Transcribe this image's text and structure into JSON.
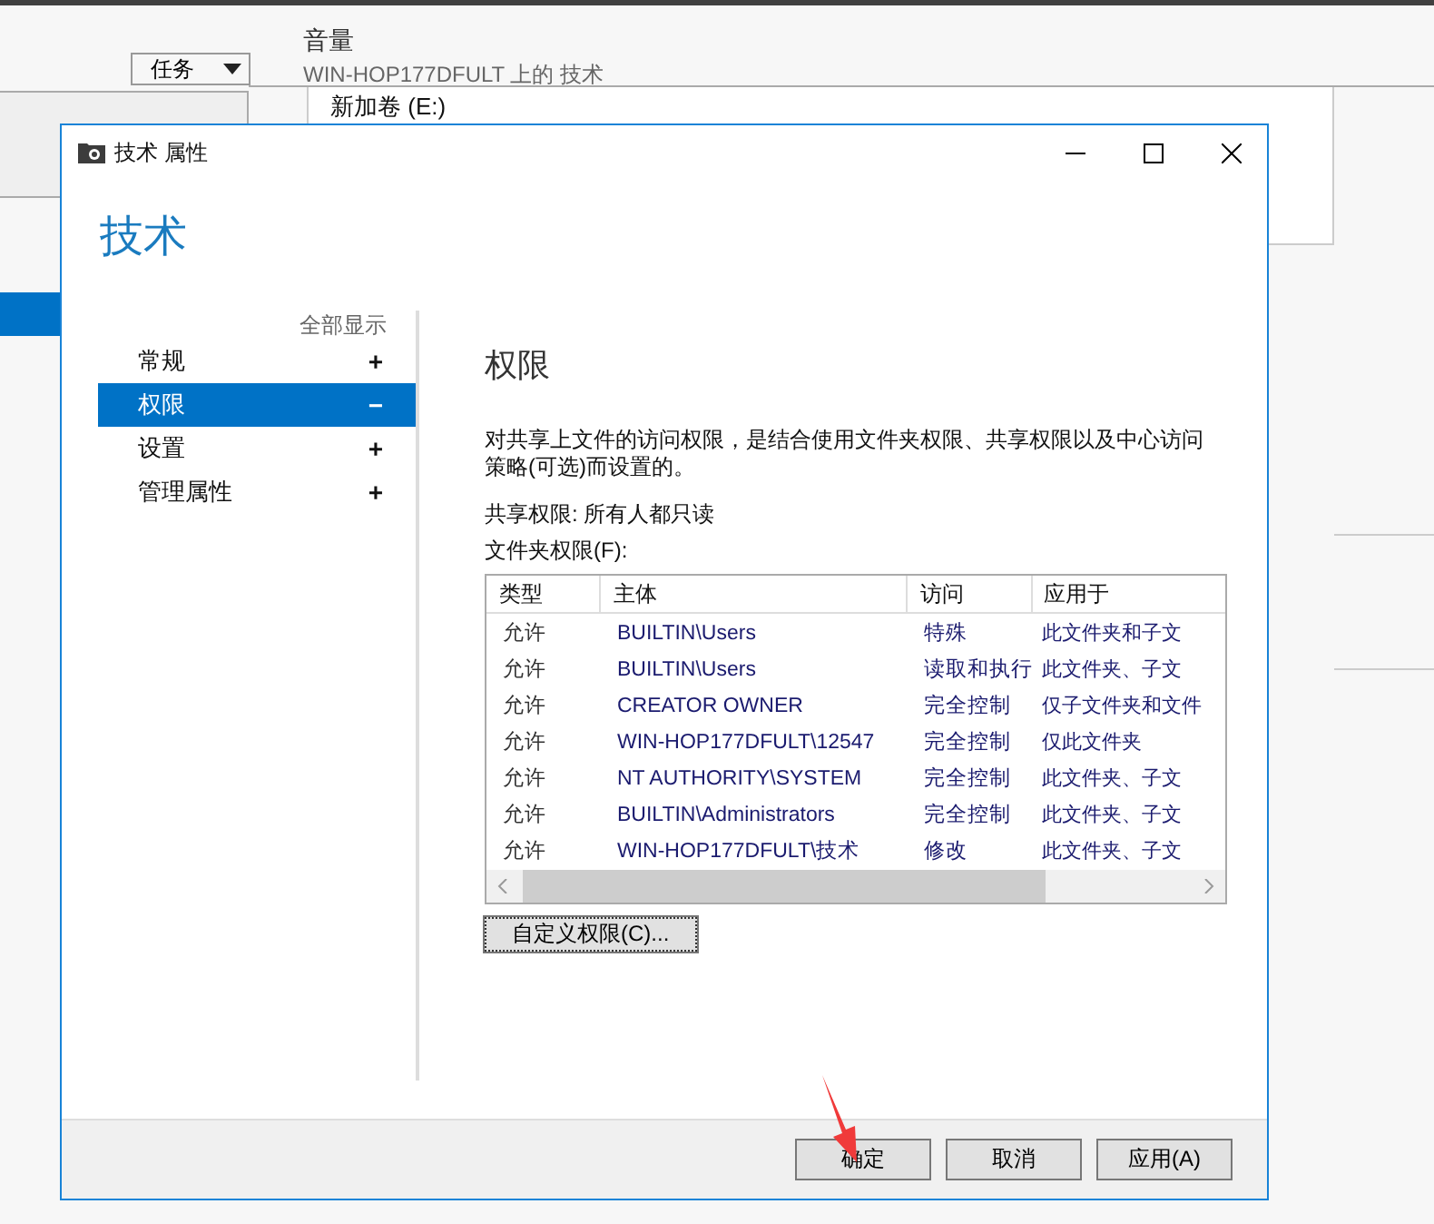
{
  "background_app": {
    "tasks_button": "任务",
    "header": {
      "title": "音量",
      "subtitle": "WIN-HOP177DFULT 上的 技术"
    },
    "volume_item": "新加卷 (E:)"
  },
  "dialog": {
    "title": "技术 属性",
    "heading": "技术",
    "show_all": "全部显示",
    "nav_items": [
      {
        "label": "常规",
        "sign": "+",
        "selected": false
      },
      {
        "label": "权限",
        "sign": "−",
        "selected": true
      },
      {
        "label": "设置",
        "sign": "+",
        "selected": false
      },
      {
        "label": "管理属性",
        "sign": "+",
        "selected": false
      }
    ],
    "section_title": "权限",
    "description": "对共享上文件的访问权限，是结合使用文件夹权限、共享权限以及中心访问策略(可选)而设置的。",
    "share_permissions": "共享权限: 所有人都只读",
    "folder_permissions_label": "文件夹权限(F):",
    "table": {
      "columns": [
        "类型",
        "主体",
        "访问",
        "应用于"
      ],
      "rows": [
        [
          "允许",
          "BUILTIN\\Users",
          "特殊",
          "此文件夹和子文"
        ],
        [
          "允许",
          "BUILTIN\\Users",
          "读取和执行",
          "此文件夹、子文"
        ],
        [
          "允许",
          "CREATOR OWNER",
          "完全控制",
          "仅子文件夹和文件"
        ],
        [
          "允许",
          "WIN-HOP177DFULT\\12547",
          "完全控制",
          "仅此文件夹"
        ],
        [
          "允许",
          "NT AUTHORITY\\SYSTEM",
          "完全控制",
          "此文件夹、子文"
        ],
        [
          "允许",
          "BUILTIN\\Administrators",
          "完全控制",
          "此文件夹、子文"
        ],
        [
          "允许",
          "WIN-HOP177DFULT\\技术",
          "修改",
          "此文件夹、子文"
        ]
      ]
    },
    "custom_button": "自定义权限(C)...",
    "buttons": [
      "确定",
      "取消",
      "应用(A)"
    ]
  }
}
